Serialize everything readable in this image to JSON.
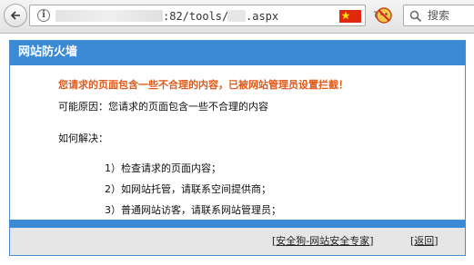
{
  "browser": {
    "url_path": ":82/tools/",
    "url_ext": ".aspx",
    "search_placeholder": "搜索"
  },
  "panel": {
    "title": "网站防火墙",
    "warning": "您请求的页面包含一些不合理的内容，已被网站管理员设置拦截！",
    "reason": "可能原因：您请求的页面包含一些不合理的内容",
    "how_to": "如何解决：",
    "steps": [
      "1）检查请求的页面内容；",
      "2）如网站托管，请联系空间提供商；",
      "3）普通网站访客，请联系网站管理员；"
    ]
  },
  "footer": {
    "expert_link": "安全狗-网站安全专家",
    "back_link": "返回"
  },
  "colors": {
    "header_blue": "#3a8ad6",
    "warning_orange": "#e05a1a",
    "footer_gray": "#e6e6e6"
  },
  "icons": [
    "back-arrow-icon",
    "info-icon",
    "china-flag-icon",
    "reload-icon",
    "blocked-addon-icon",
    "search-icon"
  ]
}
